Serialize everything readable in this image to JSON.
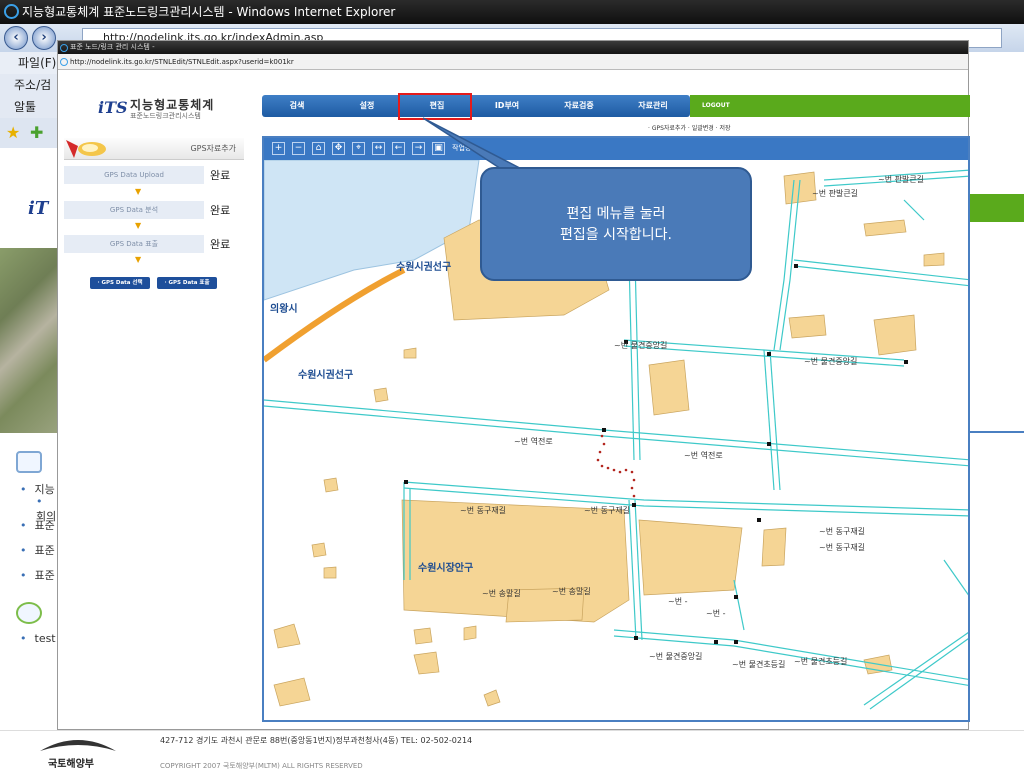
{
  "browser": {
    "title": "지능형교통체계 표준노드링크관리시스템 - Windows Internet Explorer",
    "address": "http://nodelink.its.go.kr/indexAdmin.asp",
    "menu_file": "파일(F)",
    "address_label": "주소/검",
    "links_label": "알툴"
  },
  "popup": {
    "title": "표준 노드/링크 관리 시스템 -",
    "address": "http://nodelink.its.go.kr/STNLEdit/STNLEdit.aspx?userid=k001kr"
  },
  "logo": {
    "mark": "iTS",
    "title": "지능형교통체계",
    "subtitle": "표준노드링크관리시스템"
  },
  "menu": {
    "items": [
      "검색",
      "설정",
      "편집",
      "ID부여",
      "자료검증",
      "자료관리"
    ],
    "logout": "LOGOUT",
    "submenu": "· GPS자료추가   · 일괄변경   · 저장"
  },
  "gps_panel": {
    "header": "GPS자료추가",
    "steps": [
      {
        "label": "GPS Data Upload",
        "status": "완료"
      },
      {
        "label": "GPS Data 분석",
        "status": "완료"
      },
      {
        "label": "GPS Data 표출",
        "status": "완료"
      }
    ],
    "select_button": "· GPS Data 선택",
    "display_button": "· GPS Data 표출"
  },
  "map": {
    "toolbar_text": "작업창",
    "labels": {
      "district1": "수원시권선구",
      "district2": "수원시권선구",
      "district3": "수원시장안구",
      "city": "의왕시",
      "road1": "~번 역전로",
      "road2": "~번 역전로",
      "road3": "~번 동구재길",
      "road4": "~번 동구재길",
      "road5": "~번 동구재길",
      "road6": "~번 동구재길",
      "road7": "~번 송말길",
      "road8": "~번 송말길",
      "road9": "~번 물견중앙길",
      "road10": "~번 물견중앙길",
      "road11": "~번 물견중앙길",
      "road12": "~번 물견초등길",
      "road13": "~번 물견초등길",
      "road14": "~번 판발큰길",
      "road15": "~번 판발큰길",
      "road16": "~번 -",
      "road17": "~번 -"
    }
  },
  "callout": {
    "line1": "편집 메뉴를 눌러",
    "line2": "편집을 시작합니다."
  },
  "outer_page": {
    "list_items": [
      "지능",
      "회의",
      "표준",
      "표준",
      "표준"
    ],
    "list_item2": "test"
  },
  "footer": {
    "address": "427-712 경기도 과천시 관문로 88번(중앙동1번지)정부과천청사(4동)  TEL: 02-502-0214",
    "copyright": "COPYRIGHT 2007 국토해양부(MLTM) ALL RIGHTS RESERVED",
    "org": "국토해양부"
  },
  "colors": {
    "menu_blue": "#2a67b0",
    "menu_green": "#5aaa1c",
    "highlight_red": "#e51b1b",
    "callout_blue": "#4a7ab8",
    "road_cyan": "#3ec9c9",
    "block_tan": "#f5d595"
  }
}
